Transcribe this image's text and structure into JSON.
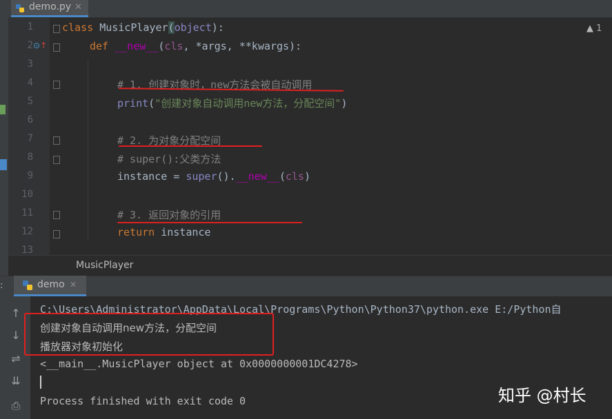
{
  "editor": {
    "tab_label": "demo.py",
    "warning_count": "1",
    "breadcrumb": "MusicPlayer",
    "lines": [
      {
        "num": "1"
      },
      {
        "num": "2"
      },
      {
        "num": "3"
      },
      {
        "num": "4"
      },
      {
        "num": "5"
      },
      {
        "num": "6"
      },
      {
        "num": "7"
      },
      {
        "num": "8"
      },
      {
        "num": "9"
      },
      {
        "num": "10"
      },
      {
        "num": "11"
      },
      {
        "num": "12"
      },
      {
        "num": "13"
      }
    ],
    "code": {
      "l1_kw": "class ",
      "l1_name": "MusicPlayer",
      "l1_open": "(",
      "l1_obj": "object",
      "l1_close": "):",
      "l2_def": "def ",
      "l2_name": "__new__",
      "l2_params_open": "(",
      "l2_cls": "cls",
      "l2_rest": ", *args, **kwargs):",
      "l4_comment": "# 1. 创建对象时，new方法会被自动调用",
      "l5_print": "print",
      "l5_open": "(",
      "l5_str": "\"创建对象自动调用new方法，分配空间\"",
      "l5_close": ")",
      "l7_comment": "# 2. 为对象分配空间",
      "l8_comment": "# super():父类方法",
      "l9_var": "instance = ",
      "l9_super": "super",
      "l9_mid": "().",
      "l9_new": "__new__",
      "l9_open": "(",
      "l9_cls": "cls",
      "l9_close": ")",
      "l11_comment": "# 3. 返回对象的引用",
      "l12_return": "return",
      "l12_rest": " instance"
    }
  },
  "run": {
    "tab_label": "demo",
    "output": {
      "path_line": "C:\\Users\\Administrator\\AppData\\Local\\Programs\\Python\\Python37\\python.exe E:/Python自",
      "line1": "创建对象自动调用new方法，分配空间",
      "line2": "播放器对象初始化",
      "line3": "<__main__.MusicPlayer object at 0x0000000001DC4278>",
      "finished": "Process finished with exit code 0"
    }
  },
  "watermark": "知乎 @村长",
  "colors": {
    "annotation_red": "#e02020",
    "keyword": "#cc7832",
    "comment": "#808080",
    "string": "#6a8759",
    "magic": "#b200b2"
  }
}
